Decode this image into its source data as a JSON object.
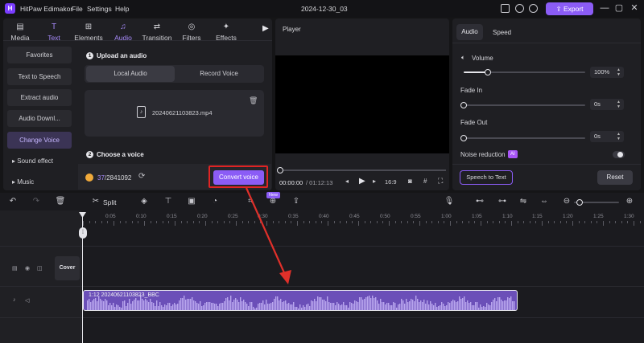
{
  "app": {
    "title": "HitPaw Edimakor",
    "project_name": "2024-12-30_03",
    "export_label": "Export"
  },
  "menu": [
    "File",
    "Settings",
    "Help"
  ],
  "toolbar": [
    {
      "label": "Media",
      "icon": "media-icon"
    },
    {
      "label": "Text",
      "icon": "text-icon"
    },
    {
      "label": "Elements",
      "icon": "elements-icon"
    },
    {
      "label": "Audio",
      "icon": "audio-icon"
    },
    {
      "label": "Transition",
      "icon": "transition-icon"
    },
    {
      "label": "Filters",
      "icon": "filters-icon"
    },
    {
      "label": "Effects",
      "icon": "effects-icon"
    }
  ],
  "sidebar": {
    "items": [
      "Favorites",
      "Text to Speech",
      "Extract audio",
      "Audio Downl...",
      "Change Voice"
    ],
    "expandables": [
      "Sound effect",
      "Music"
    ]
  },
  "change_voice": {
    "step1_title": "Upload an audio",
    "tab_local": "Local Audio",
    "tab_record": "Record Voice",
    "file_name": "20240621103823.mp4",
    "step2_title": "Choose a voice",
    "credits": "37",
    "credits_total": "/2841092",
    "convert_label": "Convert voice"
  },
  "player": {
    "title": "Player",
    "time_current": "00:00:00",
    "time_total": "/ 01:12:13",
    "aspect": "16:9"
  },
  "properties": {
    "tab_audio": "Audio",
    "tab_speed": "Speed",
    "volume_label": "Volume",
    "volume_value": "100%",
    "volume_level": 0.2,
    "fade_in_label": "Fade In",
    "fade_in_value": "0s",
    "fade_out_label": "Fade Out",
    "fade_out_value": "0s",
    "noise_label": "Noise reduction",
    "noise_badge": "AI",
    "speech_to_text_label": "Speech to Text",
    "reset_label": "Reset"
  },
  "timeline": {
    "split_label": "Split",
    "new_badge": "New",
    "ruler": [
      "0:05",
      "0:10",
      "0:15",
      "0:20",
      "0:25",
      "0:30",
      "0:35",
      "0:40",
      "0:45",
      "0:50",
      "0:55",
      "1:00",
      "1:05",
      "1:10",
      "1:15",
      "1:20",
      "1:25",
      "1:30"
    ],
    "cover_label": "Cover",
    "clip_label": "1:12  20240621103823_BBC"
  },
  "colors": {
    "accent": "#8b5cf6",
    "highlight_box": "#e02424",
    "annotation_arrow": "#e0302a"
  }
}
